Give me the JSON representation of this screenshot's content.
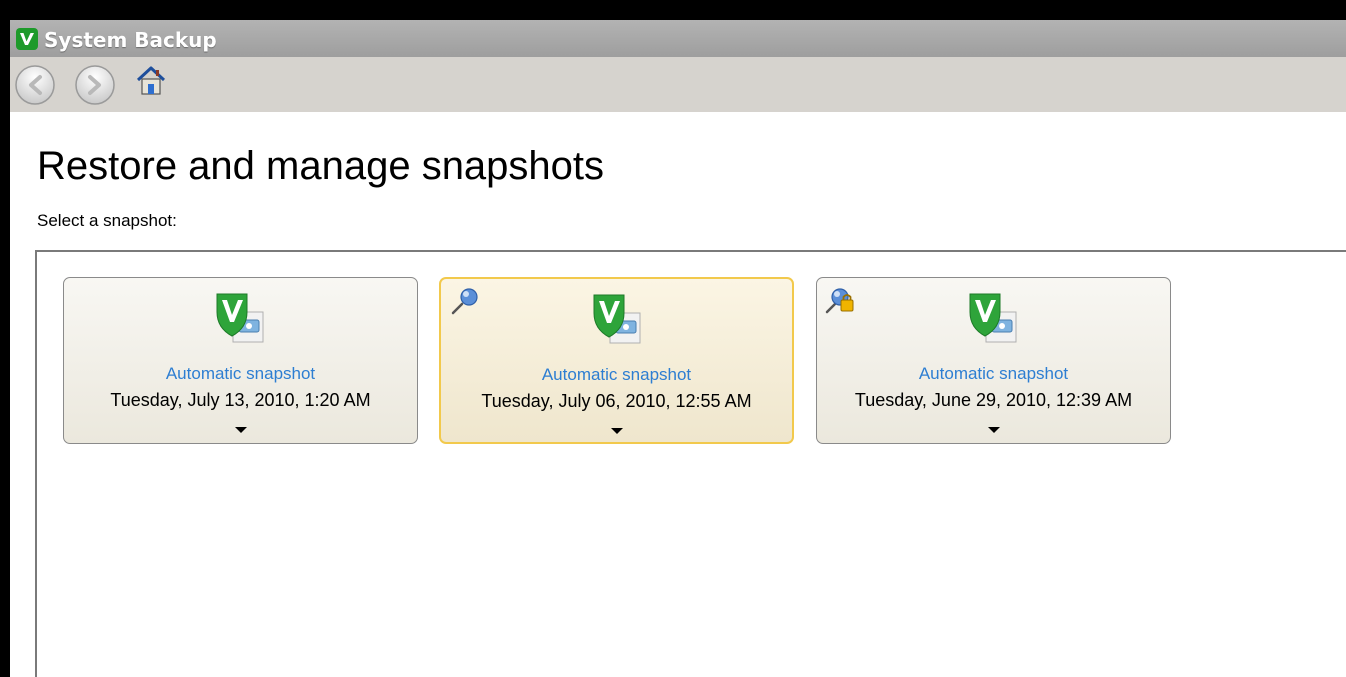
{
  "window": {
    "title": "System Backup"
  },
  "page": {
    "title": "Restore and manage snapshots",
    "subtitle": "Select a snapshot:"
  },
  "snapshots": [
    {
      "name": "Automatic snapshot",
      "date": "Tuesday, July 13, 2010, 1:20 AM",
      "selected": false,
      "badge": ""
    },
    {
      "name": "Automatic snapshot",
      "date": "Tuesday, July 06, 2010, 12:55 AM",
      "selected": true,
      "badge": "pin-icon"
    },
    {
      "name": "Automatic snapshot",
      "date": "Tuesday, June 29, 2010, 12:39 AM",
      "selected": false,
      "badge": "locked-pin-icon"
    }
  ],
  "colors": {
    "accent": "#2d7ed2",
    "selected_border": "#f2c94c",
    "titlebar": "#a8a8a8",
    "navbar": "#d6d3ce"
  }
}
